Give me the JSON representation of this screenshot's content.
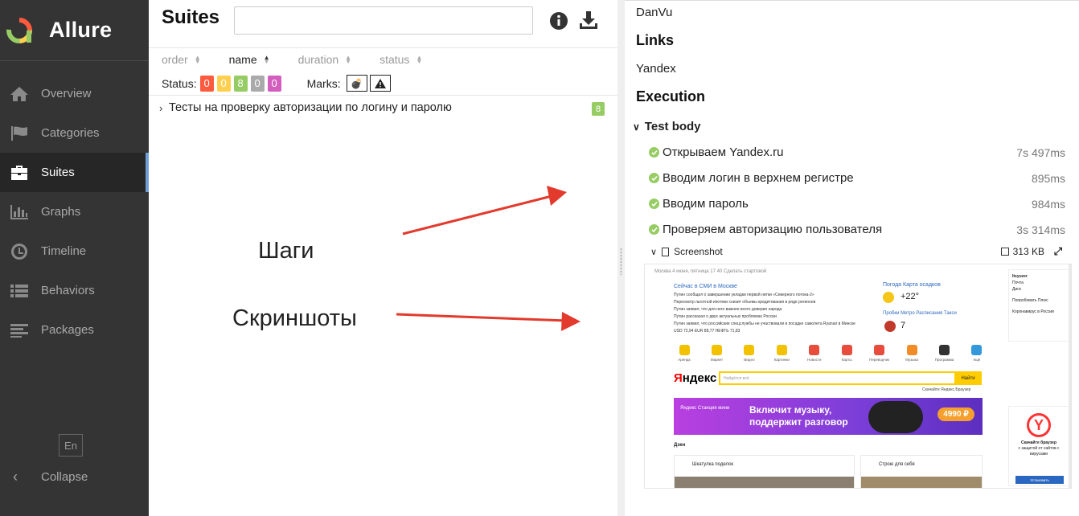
{
  "app": {
    "name": "Allure"
  },
  "sidebar": {
    "items": [
      {
        "label": "Overview",
        "icon": "home-icon"
      },
      {
        "label": "Categories",
        "icon": "flag-icon"
      },
      {
        "label": "Suites",
        "icon": "briefcase-icon",
        "active": true
      },
      {
        "label": "Graphs",
        "icon": "bar-chart-icon"
      },
      {
        "label": "Timeline",
        "icon": "clock-icon"
      },
      {
        "label": "Behaviors",
        "icon": "list-icon"
      },
      {
        "label": "Packages",
        "icon": "stack-icon"
      }
    ],
    "language": "En",
    "collapse_label": "Collapse"
  },
  "suites": {
    "title": "Suites",
    "search_value": "",
    "sort": [
      "order",
      "name",
      "duration",
      "status"
    ],
    "status_label": "Status:",
    "status_counts": [
      "0",
      "0",
      "8",
      "0",
      "0"
    ],
    "status_colors": [
      "#fd5a3e",
      "#ffd050",
      "#97cc64",
      "#aaaaaa",
      "#d35ebe"
    ],
    "marks_label": "Marks:",
    "rows": [
      {
        "title": "Тесты на проверку авторизации по логину и паролю",
        "count": "8"
      }
    ],
    "annotations": [
      "Шаги",
      "Скриншоты"
    ]
  },
  "details": {
    "owner": "DanVu",
    "links_title": "Links",
    "link": "Yandex",
    "execution_title": "Execution",
    "test_body": "Test body",
    "steps": [
      {
        "name": "Открываем Yandex.ru",
        "duration": "7s 497ms"
      },
      {
        "name": "Вводим логин в верхнем регистре",
        "duration": "895ms"
      },
      {
        "name": "Вводим пароль",
        "duration": "984ms"
      },
      {
        "name": "Проверяем авторизацию пользователя",
        "duration": "3s 314ms"
      }
    ],
    "attachment": {
      "name": "Screenshot",
      "size": "313 KB"
    }
  },
  "screenshot": {
    "top": "Москва   4 июня, пятница 17 40   Сделать стартовой",
    "news_title": "Сейчас в СМИ  в Москве",
    "news": [
      "Путин сообщил о завершении укладки первой нитки «Северного потока-2»",
      "Пересмотр льготной ипотеки снизит объемы кредитования в ряде регионов",
      "Путин заявил, что для него важнее всего доверие народа",
      "Путин рассказал о двух актуальных проблемах России",
      "Путин заявил, что российские спецслужбы не участвовали в посадке самолета Ryanair в Минске"
    ],
    "rates": "USD 72,94  EUR 88,77  НЕФТЬ 71,83",
    "weather": "Погода  Карта осадков",
    "temp": "+22°",
    "traffic": "Пробки  Метро  Расписания  Такси",
    "traffic_level": "7",
    "services": [
      "Аренда",
      "Маркет",
      "Видео",
      "Картинки",
      "Новости",
      "Карты",
      "Переводчик",
      "Музыка",
      "Программа",
      "ещё"
    ],
    "service_colors": [
      "#f2c200",
      "#f2c200",
      "#f2c200",
      "#f2c200",
      "#e74c3c",
      "#e74c3c",
      "#e74c3c",
      "#f28c28",
      "#333333",
      "#3498db"
    ],
    "logo_first": "Я",
    "logo_rest": "ндекс",
    "search_placeholder": "Найдётся всё",
    "search_button": "Найти",
    "browser_hint": "Скачайте Яндекс.Браузер",
    "banner_brand": "Яндекс Станция мини",
    "banner_text": "Включит музыку, поддержит разговор",
    "banner_price": "4990 ₽",
    "dzen": "Дзен",
    "cards": [
      "Шкатулка поделок",
      "Строю для себя"
    ],
    "side_user": "Itsyuzer",
    "side_mail": "Почта",
    "side_disk": "Диск",
    "side_plus": "Попробовать Плюс",
    "side_covid": "Коронавирус в России",
    "browser_title": "Скачайте браузер",
    "browser_sub": "с защитой от сайтов с вирусами",
    "browser_install": "Установить"
  }
}
